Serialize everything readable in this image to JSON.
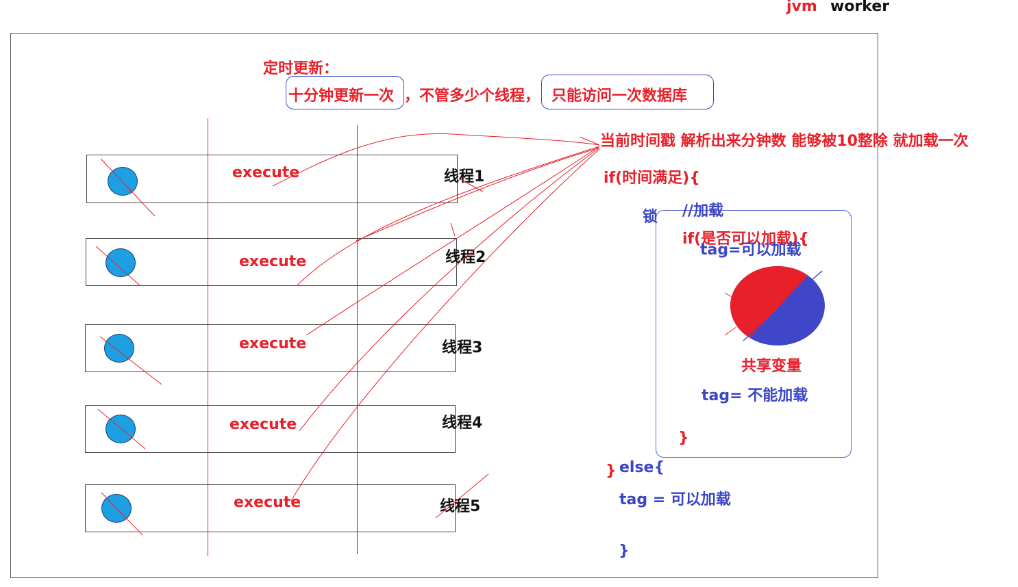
{
  "header": {
    "jvm": "jvm",
    "worker": "worker"
  },
  "title": {
    "timed_update": "定时更新：",
    "once_per_10min": "十分钟更新一次",
    "middle": "，不管多少个线程，",
    "db_once": "只能访问一次数据库"
  },
  "rows": [
    {
      "execute": "execute",
      "thread": "线程1"
    },
    {
      "execute": "execute",
      "thread": "线程2"
    },
    {
      "execute": "execute",
      "thread": "线程3"
    },
    {
      "execute": "execute",
      "thread": "线程4"
    },
    {
      "execute": "execute",
      "thread": "线程5"
    }
  ],
  "code": {
    "timestamp_note": "当前时间戳  解析出来分钟数 能够被10整除 就加载一次",
    "if_time": "if(时间满足){",
    "lock": "锁",
    "comment_load": "//加载",
    "if_can_load": "if(是否可以加载){",
    "tag_can_load_top": "tag=可以加载",
    "shared_variable": "共享变量",
    "tag_cannot_load": "tag= 不能加载",
    "close_inner": "}",
    "close_if_time": "}",
    "else_open": "else{",
    "tag_can_load_else": "tag  = 可以加载",
    "close_else": "}"
  },
  "colors": {
    "red": "#e8202a",
    "blue": "#3a46c4",
    "dot": "#1d9fe3"
  }
}
